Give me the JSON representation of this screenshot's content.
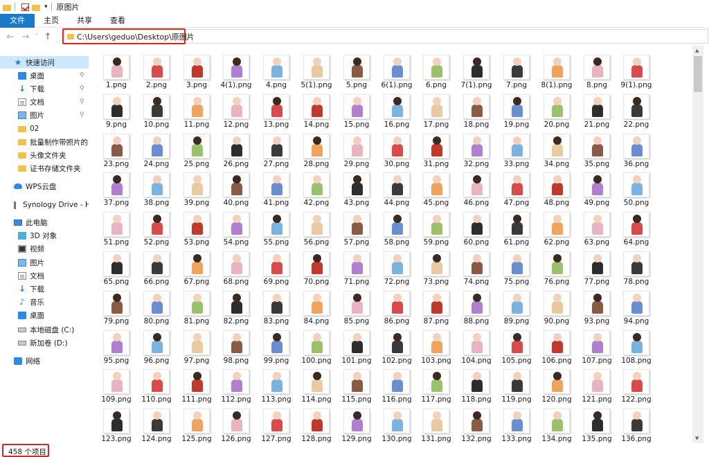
{
  "window": {
    "title": "原图片"
  },
  "ribbon": {
    "tabs": [
      "文件",
      "主页",
      "共享",
      "查看"
    ]
  },
  "navigation": {
    "back": "←",
    "forward": "→",
    "up": "↑"
  },
  "address": {
    "path": "C:\\Users\\geduo\\Desktop\\原图片"
  },
  "sidebar": {
    "items": [
      {
        "label": "快速访问",
        "icon": "star-icon",
        "level": 0,
        "selected": true
      },
      {
        "label": "桌面",
        "icon": "desktop-icon",
        "level": 1,
        "pinned": true
      },
      {
        "label": "下载",
        "icon": "download-icon",
        "level": 1,
        "pinned": true
      },
      {
        "label": "文档",
        "icon": "document-icon",
        "level": 1,
        "pinned": true
      },
      {
        "label": "图片",
        "icon": "pictures-icon",
        "level": 1,
        "pinned": true
      },
      {
        "label": "02",
        "icon": "folder-icon",
        "level": 1
      },
      {
        "label": "批量制作带照片的证",
        "icon": "folder-icon",
        "level": 1
      },
      {
        "label": "头像文件夹",
        "icon": "folder-icon",
        "level": 1
      },
      {
        "label": "证书存储文件夹",
        "icon": "folder-icon",
        "level": 1
      },
      {
        "label": "WPS云盘",
        "icon": "cloud-icon",
        "level": 0
      },
      {
        "label": "Synology Drive - HO",
        "icon": "synology-icon",
        "level": 0
      },
      {
        "label": "此电脑",
        "icon": "computer-icon",
        "level": 0
      },
      {
        "label": "3D 对象",
        "icon": "3d-objects-icon",
        "level": 1
      },
      {
        "label": "视频",
        "icon": "video-icon",
        "level": 1
      },
      {
        "label": "图片",
        "icon": "pictures-icon",
        "level": 1
      },
      {
        "label": "文档",
        "icon": "document-icon",
        "level": 1
      },
      {
        "label": "下载",
        "icon": "download-icon",
        "level": 1
      },
      {
        "label": "音乐",
        "icon": "music-icon",
        "level": 1
      },
      {
        "label": "桌面",
        "icon": "desktop-icon",
        "level": 1
      },
      {
        "label": "本地磁盘 (C:)",
        "icon": "drive-icon",
        "level": 1
      },
      {
        "label": "新加卷 (D:)",
        "icon": "drive-icon",
        "level": 1
      },
      {
        "label": "网络",
        "icon": "network-icon",
        "level": 0
      }
    ]
  },
  "files": [
    "1.png",
    "2.png",
    "3.png",
    "4(1).png",
    "4.png",
    "5(1).png",
    "5.png",
    "6(1).png",
    "6.png",
    "7(1).png",
    "7.png",
    "8(1).png",
    "8.png",
    "9(1).png",
    "9.png",
    "10.png",
    "11.png",
    "12.png",
    "13.png",
    "14.png",
    "15.png",
    "16.png",
    "17.png",
    "18.png",
    "19.png",
    "20.png",
    "21.png",
    "22.png",
    "23.png",
    "24.png",
    "25.png",
    "26.png",
    "27.png",
    "28.png",
    "29.png",
    "30.png",
    "31.png",
    "32.png",
    "33.png",
    "34.png",
    "35.png",
    "36.png",
    "37.png",
    "38.png",
    "39.png",
    "40.png",
    "41.png",
    "42.png",
    "43.png",
    "44.png",
    "45.png",
    "46.png",
    "47.png",
    "48.png",
    "49.png",
    "50.png",
    "51.png",
    "52.png",
    "53.png",
    "54.png",
    "55.png",
    "56.png",
    "57.png",
    "58.png",
    "59.png",
    "60.png",
    "61.png",
    "62.png",
    "63.png",
    "64.png",
    "65.png",
    "66.png",
    "67.png",
    "68.png",
    "69.png",
    "70.png",
    "71.png",
    "72.png",
    "73.png",
    "74.png",
    "75.png",
    "76.png",
    "77.png",
    "78.png",
    "79.png",
    "80.png",
    "81.png",
    "82.png",
    "83.png",
    "84.png",
    "85.png",
    "86.png",
    "87.png",
    "88.png",
    "89.png",
    "90.png",
    "93.png",
    "94.png",
    "95.png",
    "96.png",
    "97.png",
    "98.png",
    "99.png",
    "100.png",
    "101.png",
    "102.png",
    "103.png",
    "104.png",
    "105.png",
    "106.png",
    "107.png",
    "108.png",
    "109.png",
    "110.png",
    "111.png",
    "112.png",
    "113.png",
    "114.png",
    "115.png",
    "116.png",
    "117.png",
    "118.png",
    "119.png",
    "120.png",
    "121.png",
    "122.png",
    "123.png",
    "124.png",
    "125.png",
    "126.png",
    "127.png",
    "128.png",
    "129.png",
    "130.png",
    "131.png",
    "132.png",
    "133.png",
    "134.png",
    "135.png",
    "136.png"
  ],
  "thumb_palette": [
    "#e9b3c0",
    "#6a8fd0",
    "#c0392b",
    "#2d2d2d",
    "#7bb3e0",
    "#f0a35a",
    "#8a5a44",
    "#d94a4a",
    "#9bc16b",
    "#b07fd0",
    "#3a3a3a",
    "#e8c9a0"
  ],
  "status": {
    "item_count": "458 个项目"
  },
  "colors": {
    "accent": "#1979ca",
    "selection": "#cce8ff",
    "highlight_box": "#e0241c"
  }
}
